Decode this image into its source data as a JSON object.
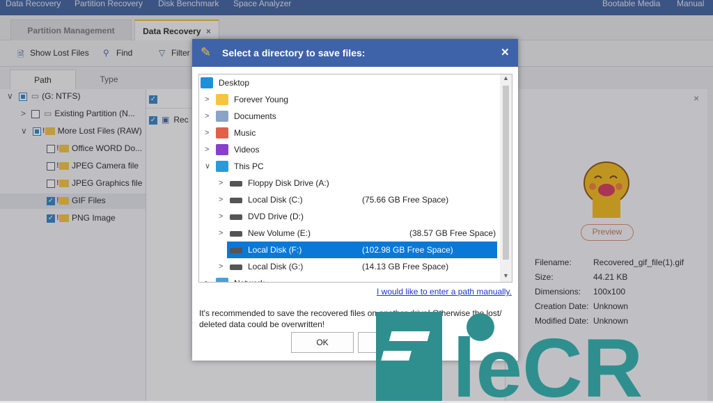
{
  "menu": {
    "items": [
      "Data Recovery",
      "Partition Recovery",
      "Disk Benchmark",
      "Space Analyzer"
    ],
    "right": [
      "Bootable Media",
      "Manual"
    ]
  },
  "tabs": [
    {
      "label": "Partition Management"
    },
    {
      "label": "Data Recovery",
      "close": "×"
    }
  ],
  "toolbar": {
    "show_lost": "Show Lost Files",
    "find": "Find",
    "filter": "Filter"
  },
  "side_tabs": [
    "Path",
    "Type"
  ],
  "tree": [
    {
      "label": "(G: NTFS)",
      "expand": "∨",
      "check": "partial"
    },
    {
      "label": "Existing Partition (N...",
      "expand": ">",
      "check": "off"
    },
    {
      "label": "More Lost Files (RAW)",
      "expand": "∨",
      "check": "partial"
    },
    {
      "label": "Office WORD Do...",
      "check": "off"
    },
    {
      "label": "JPEG Camera file",
      "check": "off"
    },
    {
      "label": "JPEG Graphics file",
      "check": "off"
    },
    {
      "label": "GIF Files",
      "check": "on"
    },
    {
      "label": "PNG Image",
      "check": "on"
    }
  ],
  "file_list": {
    "row_label": "Rec"
  },
  "preview": {
    "close": "×",
    "button": "Preview",
    "details": [
      [
        "Filename:",
        "Recovered_gif_file(1).gif"
      ],
      [
        "Size:",
        "44.21 KB"
      ],
      [
        "Dimensions:",
        "100x100"
      ],
      [
        "Creation Date:",
        "Unknown"
      ],
      [
        "Modified Date:",
        "Unknown"
      ]
    ]
  },
  "dialog": {
    "title": "Select a directory to save files:",
    "close": "✕",
    "items": [
      {
        "label": "Desktop",
        "icon": "desktop-icon",
        "color": "#1e90d6",
        "level": 0
      },
      {
        "label": "Forever Young",
        "icon": "folder-icon",
        "color": "#f5c542",
        "level": 1
      },
      {
        "label": "Documents",
        "icon": "documents-icon",
        "color": "#8aa4c8",
        "level": 1
      },
      {
        "label": "Music",
        "icon": "music-icon",
        "color": "#e0604a",
        "level": 1
      },
      {
        "label": "Videos",
        "icon": "videos-icon",
        "color": "#8a3fc8",
        "level": 1
      },
      {
        "label": "This PC",
        "icon": "computer-icon",
        "color": "#2a9ad8",
        "level": 1,
        "expanded": true
      },
      {
        "label": "Floppy Disk Drive (A:)",
        "icon": "floppy-icon",
        "color": "#555",
        "level": 2,
        "free": ""
      },
      {
        "label": "Local Disk (C:)",
        "icon": "windows-disk-icon",
        "color": "#555",
        "level": 2,
        "free": "(75.66 GB Free Space)"
      },
      {
        "label": "DVD Drive (D:)",
        "icon": "dvd-icon",
        "color": "#555",
        "level": 2,
        "free": ""
      },
      {
        "label": "New Volume (E:)",
        "icon": "disk-icon",
        "color": "#555",
        "level": 2,
        "free": "(38.57 GB Free Space)"
      },
      {
        "label": "Local Disk (F:)",
        "icon": "disk-icon",
        "color": "#555",
        "level": 2,
        "free": "(102.98 GB Free Space)",
        "selected": true
      },
      {
        "label": "Local Disk (G:)",
        "icon": "disk-icon",
        "color": "#555",
        "level": 2,
        "free": "(14.13 GB Free Space)"
      },
      {
        "label": "Network",
        "icon": "network-icon",
        "color": "#4aa0d8",
        "level": 1
      }
    ],
    "manual_link": "I would like to enter a path manually.",
    "warning": "It's recommended to save the recovered files on another drive! Otherwise the lost/ deleted data could be overwritten!",
    "ok": "OK",
    "cancel": "Cancel"
  },
  "watermark": "FileCR",
  "colors": {
    "accent": "#3f63a8",
    "selection": "#0a78d7",
    "watermark": "#2f8f8f"
  }
}
